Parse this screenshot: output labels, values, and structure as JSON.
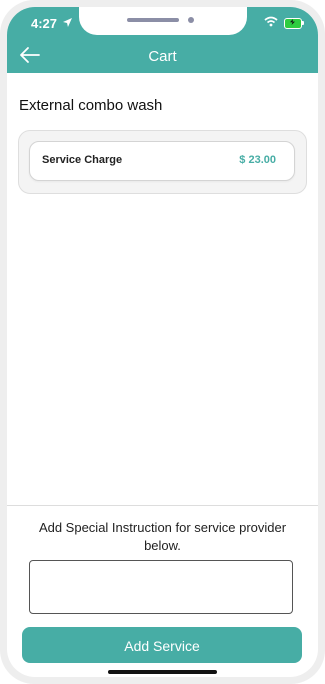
{
  "status_bar": {
    "time": "4:27"
  },
  "header": {
    "title": "Cart",
    "back_icon": "arrow-left-icon",
    "background": "#47ada5"
  },
  "service": {
    "name": "External combo wash",
    "items": [
      {
        "label": "Service Charge",
        "price": "$ 23.00"
      }
    ]
  },
  "instructions": {
    "label": "Add Special Instruction for service provider below.",
    "value": ""
  },
  "actions": {
    "add_service_label": "Add Service"
  },
  "colors": {
    "accent": "#47ada5"
  }
}
